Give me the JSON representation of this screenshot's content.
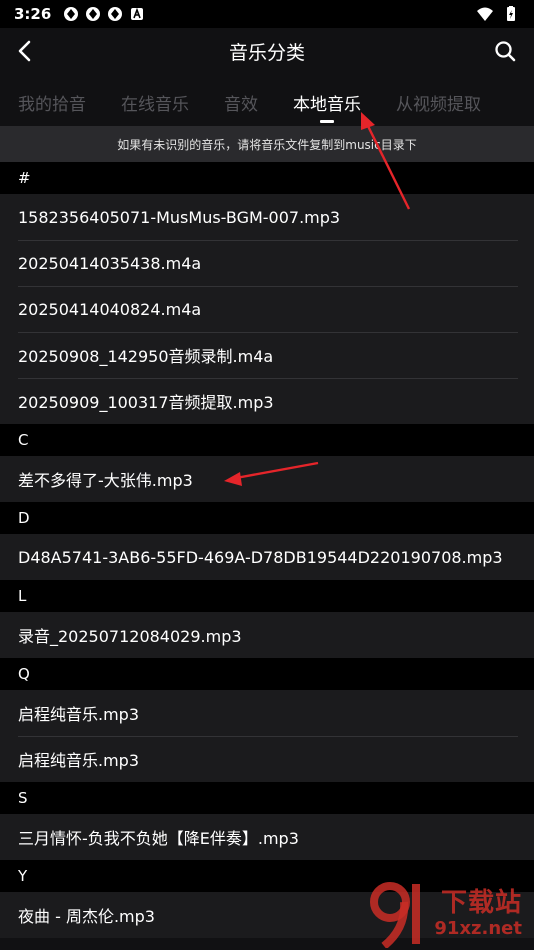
{
  "status": {
    "time": "3:26"
  },
  "header": {
    "title": "音乐分类"
  },
  "tabs": [
    {
      "label": "我的拾音",
      "active": false
    },
    {
      "label": "在线音乐",
      "active": false
    },
    {
      "label": "音效",
      "active": false
    },
    {
      "label": "本地音乐",
      "active": true
    },
    {
      "label": "从视频提取",
      "active": false
    }
  ],
  "notice": "如果有未识别的音乐，请将音乐文件复制到music目录下",
  "sections": [
    {
      "letter": "#",
      "items": [
        "1582356405071-MusMus-BGM-007.mp3",
        "20250414035438.m4a",
        "20250414040824.m4a",
        "20250908_142950音频录制.m4a",
        "20250909_100317音频提取.mp3"
      ]
    },
    {
      "letter": "C",
      "items": [
        "差不多得了-大张伟.mp3"
      ]
    },
    {
      "letter": "D",
      "items": [
        "D48A5741-3AB6-55FD-469A-D78DB19544D220190708.mp3"
      ]
    },
    {
      "letter": "L",
      "items": [
        "录音_20250712084029.mp3"
      ]
    },
    {
      "letter": "Q",
      "items": [
        "启程纯音乐.mp3",
        "启程纯音乐.mp3"
      ]
    },
    {
      "letter": "S",
      "items": [
        "三月情怀-负我不负她【降E伴奏】.mp3"
      ]
    },
    {
      "letter": "Y",
      "items": [
        "夜曲 - 周杰伦.mp3"
      ]
    }
  ],
  "watermark": {
    "name": "下载站",
    "url": "91xz.net"
  },
  "colors": {
    "background": "#111113",
    "item": "#1b1b1d",
    "section": "#000000",
    "annotation": "#e5252a"
  }
}
